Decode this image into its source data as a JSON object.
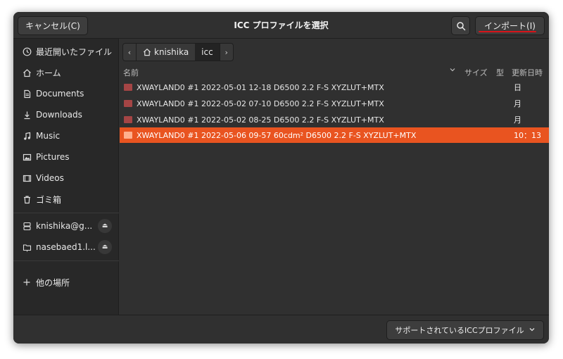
{
  "header": {
    "cancel_label": "キャンセル(C)",
    "title": "ICC プロファイルを選択",
    "import_label": "インポート(I)"
  },
  "sidebar": {
    "places": [
      {
        "label": "最近開いたファイル",
        "icon": "clock-icon"
      },
      {
        "label": "ホーム",
        "icon": "home-icon"
      },
      {
        "label": "Documents",
        "icon": "document-icon"
      },
      {
        "label": "Downloads",
        "icon": "download-icon"
      },
      {
        "label": "Music",
        "icon": "music-icon"
      },
      {
        "label": "Pictures",
        "icon": "picture-icon"
      },
      {
        "label": "Videos",
        "icon": "video-icon"
      },
      {
        "label": "ゴミ箱",
        "icon": "trash-icon"
      }
    ],
    "mounts": [
      {
        "label": "knishika@g...",
        "icon": "server-icon"
      },
      {
        "label": "nasebaed1.l...",
        "icon": "network-folder-icon"
      }
    ],
    "other_locations": "他の場所"
  },
  "pathbar": {
    "segments": [
      "knishika",
      "icc"
    ]
  },
  "columns": {
    "name": "名前",
    "size": "サイズ",
    "type": "型",
    "modified": "更新日時"
  },
  "files": [
    {
      "name": "XWAYLAND0 #1 2022-05-01 12-18 D6500 2.2 F-S XYZLUT+MTX",
      "modified": "日"
    },
    {
      "name": "XWAYLAND0 #1 2022-05-02 07-10 D6500 2.2 F-S XYZLUT+MTX",
      "modified": "月"
    },
    {
      "name": "XWAYLAND0 #1 2022-05-02 08-25 D6500 2.2 F-S XYZLUT+MTX",
      "modified": "月"
    },
    {
      "name": "XWAYLAND0 #1 2022-05-06 09-57 60cdm² D6500 2.2 F-S XYZLUT+MTX",
      "modified": "10：13"
    }
  ],
  "footer": {
    "filter_label": "サポートされているICCプロファイル"
  },
  "colors": {
    "accent": "#e95420",
    "underline": "#d8141a"
  }
}
